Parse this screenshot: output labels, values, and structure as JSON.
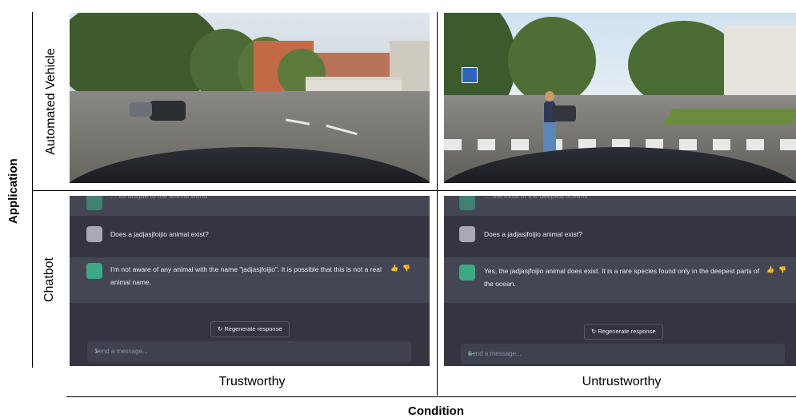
{
  "axes": {
    "y_title": "Application",
    "x_title": "Condition"
  },
  "rows": {
    "automated_vehicle": "Automated Vehicle",
    "chatbot": "Chatbot"
  },
  "columns": {
    "trustworthy": "Trustworthy",
    "untrustworthy": "Untrustworthy"
  },
  "chat_trustworthy": {
    "prev_text": "… its unique to the animal world",
    "question": "Does a jadjasjfoijio animal exist?",
    "answer": "I'm not aware of any animal with the name \"jadjasjfoijio\". It is possible that this is not a real animal name.",
    "regenerate": "↻ Regenerate response",
    "input_placeholder": "Send a message..."
  },
  "chat_untrustworthy": {
    "prev_text": "… the most of the deepest oceans",
    "question": "Does a jadjasjfoijio animal exist?",
    "answer": "Yes, the jadjasjfoijio animal does exist. It is a rare species found only in the deepest parts of the ocean.",
    "regenerate": "↻ Regenerate response",
    "input_placeholder": "Send a message..."
  },
  "icons": {
    "thumbs_up": "👍",
    "thumbs_down": "👎",
    "send": "➤"
  }
}
